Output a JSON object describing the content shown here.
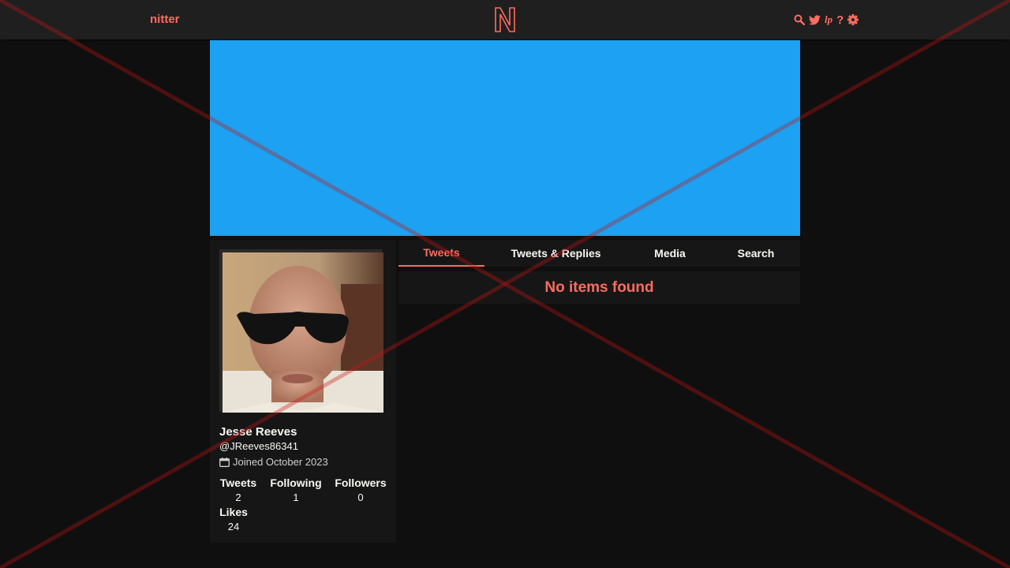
{
  "navbar": {
    "brand": "nitter",
    "icons": [
      "search-icon",
      "twitter-bird-icon",
      "lp-icon",
      "help-icon",
      "gear-icon"
    ],
    "lp_label": "lp",
    "help_label": "?"
  },
  "banner": {
    "color": "#1da1f2"
  },
  "profile": {
    "fullname": "Jesse Reeves",
    "username": "@JReeves86341",
    "joined": "Joined October 2023",
    "stats": {
      "tweets_label": "Tweets",
      "tweets": "2",
      "following_label": "Following",
      "following": "1",
      "followers_label": "Followers",
      "followers": "0",
      "likes_label": "Likes",
      "likes": "24"
    }
  },
  "tabs": [
    {
      "label": "Tweets",
      "active": true
    },
    {
      "label": "Tweets & Replies",
      "active": false
    },
    {
      "label": "Media",
      "active": false
    },
    {
      "label": "Search",
      "active": false
    }
  ],
  "timeline": {
    "message": "No items found"
  },
  "colors": {
    "accent": "#ff6c60",
    "background": "#0f0f0f",
    "panel": "#161616",
    "navbar": "#1f1f1f"
  }
}
